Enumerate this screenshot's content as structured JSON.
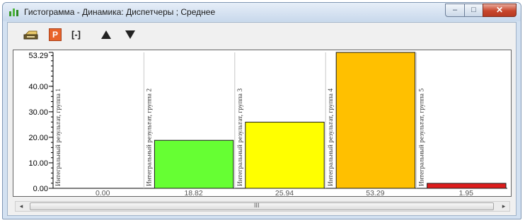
{
  "window": {
    "title": "Гистограмма - Динамика: Диспетчеры ; Среднее",
    "controls": {
      "minimize": "–",
      "maximize": "□",
      "close": "✕"
    }
  },
  "toolbar": {
    "tools": [
      {
        "icon": "print-icon"
      },
      {
        "icon": "p-letter-icon",
        "label": "P"
      },
      {
        "icon": "bracket-range-icon",
        "label": "[-]"
      },
      {
        "icon": "triangle-up-icon"
      },
      {
        "icon": "triangle-down-icon"
      }
    ]
  },
  "chart_data": {
    "type": "bar",
    "categories": [
      "Интегральный результат, группа 1",
      "Интегральный результат, группа 2",
      "Интегральный результат, группа 3",
      "Интегральный результат, группа 4",
      "Интегральный результат, группа 5"
    ],
    "values": [
      0.0,
      18.82,
      25.94,
      53.29,
      1.95
    ],
    "value_labels": [
      "0.00",
      "18.82",
      "25.94",
      "53.29",
      "1.95"
    ],
    "colors": [
      "#ffffff",
      "#66ff33",
      "#ffff00",
      "#ffc000",
      "#dd1d1d"
    ],
    "ylim": [
      0,
      53.29
    ],
    "yticks": [
      0,
      10,
      20,
      30,
      40,
      53.29
    ],
    "ytick_labels": [
      "0.00",
      "10.00",
      "20.00",
      "30.00",
      "40.00",
      "53.29"
    ],
    "grid": false
  },
  "scrollbar": {
    "left_arrow": "◂",
    "right_arrow": "▸",
    "grip": "III"
  }
}
